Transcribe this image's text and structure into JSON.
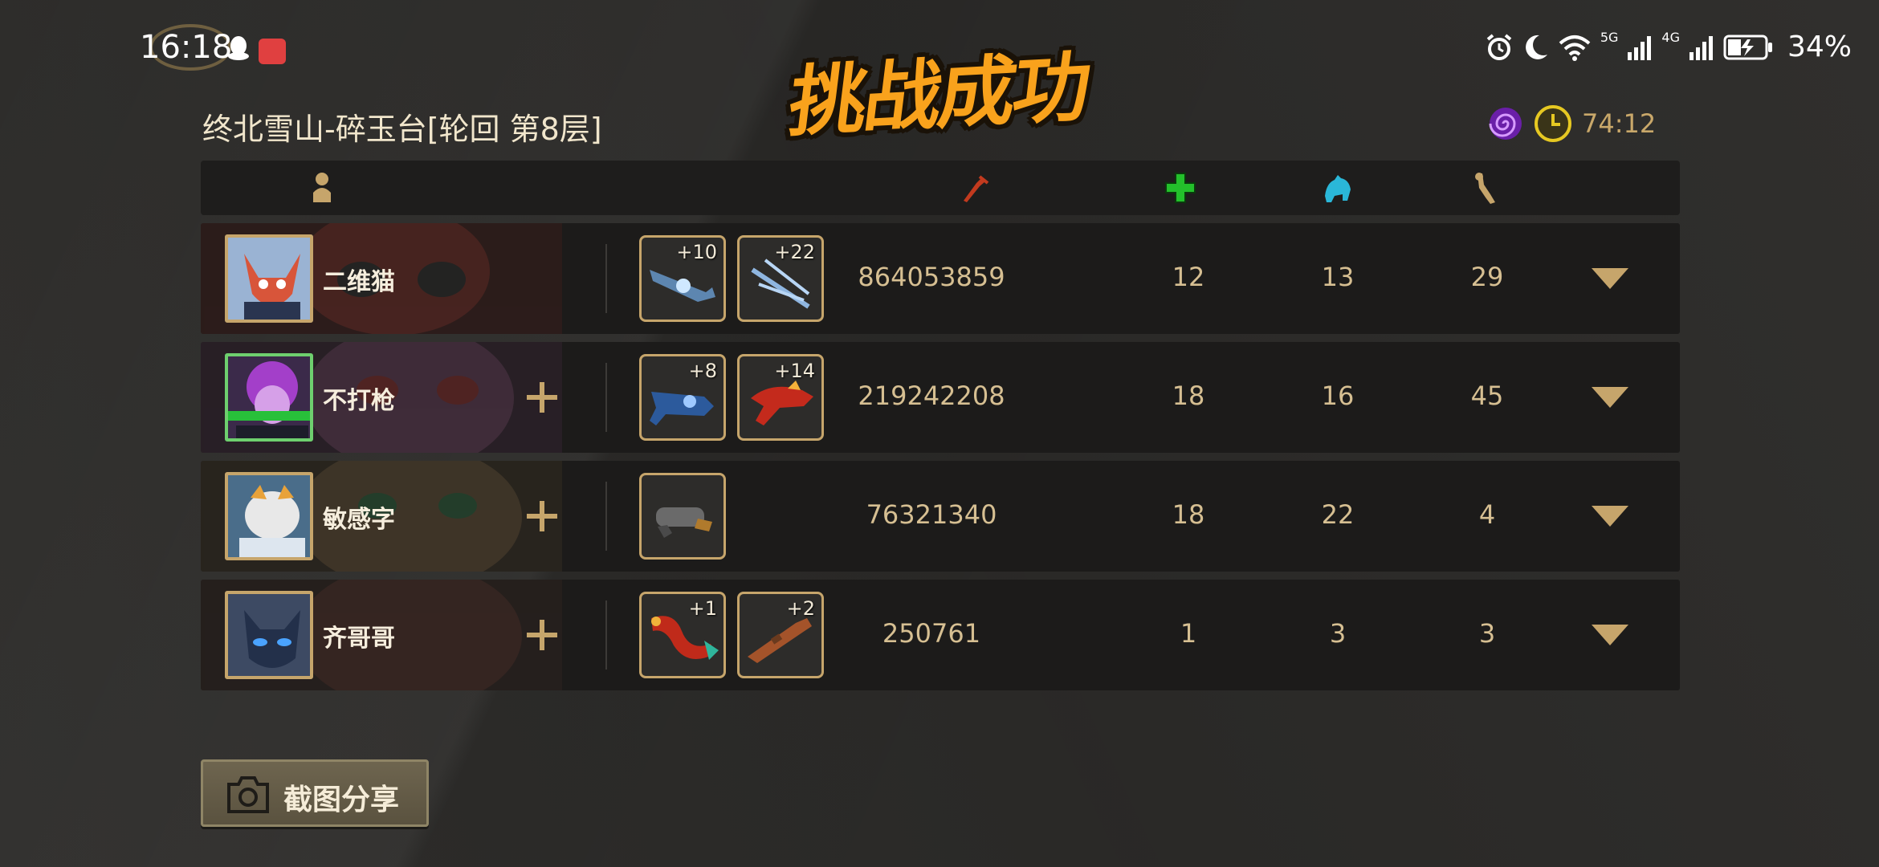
{
  "status_bar": {
    "time": "16:18",
    "battery": "34%",
    "net1": "5G",
    "net2": "4G"
  },
  "title": "挑战成功",
  "level_name": "终北雪山-碎玉台[轮回  第8层]",
  "timer": "74:12",
  "header_icons": [
    "player-icon",
    "damage-icon",
    "heal-icon",
    "revive-icon",
    "kill-icon"
  ],
  "players": [
    {
      "name": "二维猫",
      "weapons": [
        {
          "level": "+10",
          "icon": "blue-rifle-icon"
        },
        {
          "level": "+22",
          "icon": "ice-trident-icon"
        }
      ],
      "damage": "864053859",
      "heal": "12",
      "revive": "13",
      "kill": "29",
      "can_add": false
    },
    {
      "name": "不打枪",
      "weapons": [
        {
          "level": "+8",
          "icon": "blue-cannon-icon"
        },
        {
          "level": "+14",
          "icon": "red-dragon-gun-icon"
        }
      ],
      "damage": "219242208",
      "heal": "18",
      "revive": "16",
      "kill": "45",
      "can_add": true
    },
    {
      "name": "敏感字",
      "weapons": [
        {
          "level": "",
          "icon": "shotgun-icon"
        }
      ],
      "damage": "76321340",
      "heal": "18",
      "revive": "22",
      "kill": "4",
      "can_add": true
    },
    {
      "name": "齐哥哥",
      "weapons": [
        {
          "level": "+1",
          "icon": "dragon-icon"
        },
        {
          "level": "+2",
          "icon": "bronze-rifle-icon"
        }
      ],
      "damage": "250761",
      "heal": "1",
      "revive": "3",
      "kill": "3",
      "can_add": true
    }
  ],
  "share_button": {
    "label": "截图分享"
  },
  "colors": {
    "gold": "#c6a56b",
    "title_orange": "#f9a21c",
    "row_bg": "#1c1b1a"
  }
}
